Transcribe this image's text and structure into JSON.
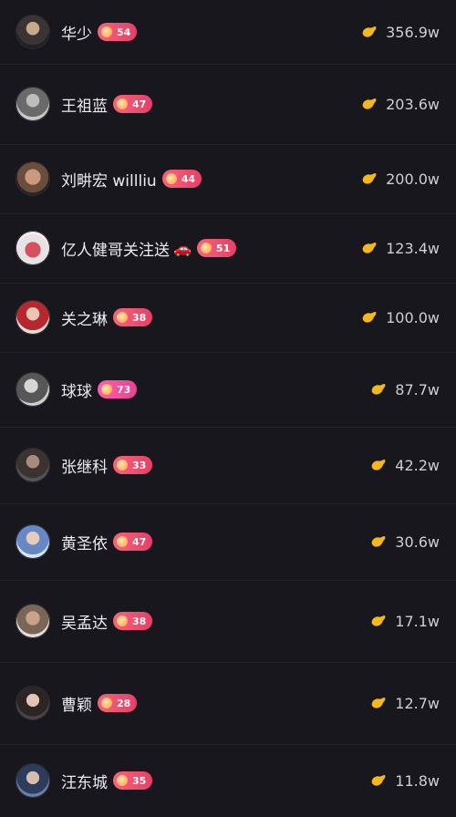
{
  "accent_colors": {
    "badge": "#e73f68",
    "bean": "#f4b81a",
    "background": "#18171d"
  },
  "items": [
    {
      "name": "华少",
      "level": "54",
      "amount": "356.9w",
      "avatar": "avatar-man-glasses",
      "badge_style": "red"
    },
    {
      "name": "王祖蓝",
      "level": "47",
      "amount": "203.6w",
      "avatar": "avatar-bw-portrait",
      "badge_style": "red"
    },
    {
      "name": "刘畊宏 willliu",
      "level": "44",
      "amount": "200.0w",
      "avatar": "avatar-shirtless-man",
      "badge_style": "red"
    },
    {
      "name": "亿人健哥关注送",
      "level": "51",
      "amount": "123.4w",
      "avatar": "avatar-car",
      "badge_style": "red",
      "emoji": "🚗"
    },
    {
      "name": "关之琳",
      "level": "38",
      "amount": "100.0w",
      "avatar": "avatar-woman",
      "badge_style": "red"
    },
    {
      "name": "球球",
      "level": "73",
      "amount": "87.7w",
      "avatar": "avatar-bw-woman",
      "badge_style": "pink"
    },
    {
      "name": "张继科",
      "level": "33",
      "amount": "42.2w",
      "avatar": "avatar-man-dark",
      "badge_style": "red"
    },
    {
      "name": "黄圣依",
      "level": "47",
      "amount": "30.6w",
      "avatar": "avatar-woman-blue",
      "badge_style": "red"
    },
    {
      "name": "吴孟达",
      "level": "38",
      "amount": "17.1w",
      "avatar": "avatar-older-man",
      "badge_style": "red"
    },
    {
      "name": "曹颖",
      "level": "28",
      "amount": "12.7w",
      "avatar": "avatar-woman-dark",
      "badge_style": "red"
    },
    {
      "name": "汪东城",
      "level": "35",
      "amount": "11.8w",
      "avatar": "avatar-man-blue",
      "badge_style": "red"
    }
  ]
}
